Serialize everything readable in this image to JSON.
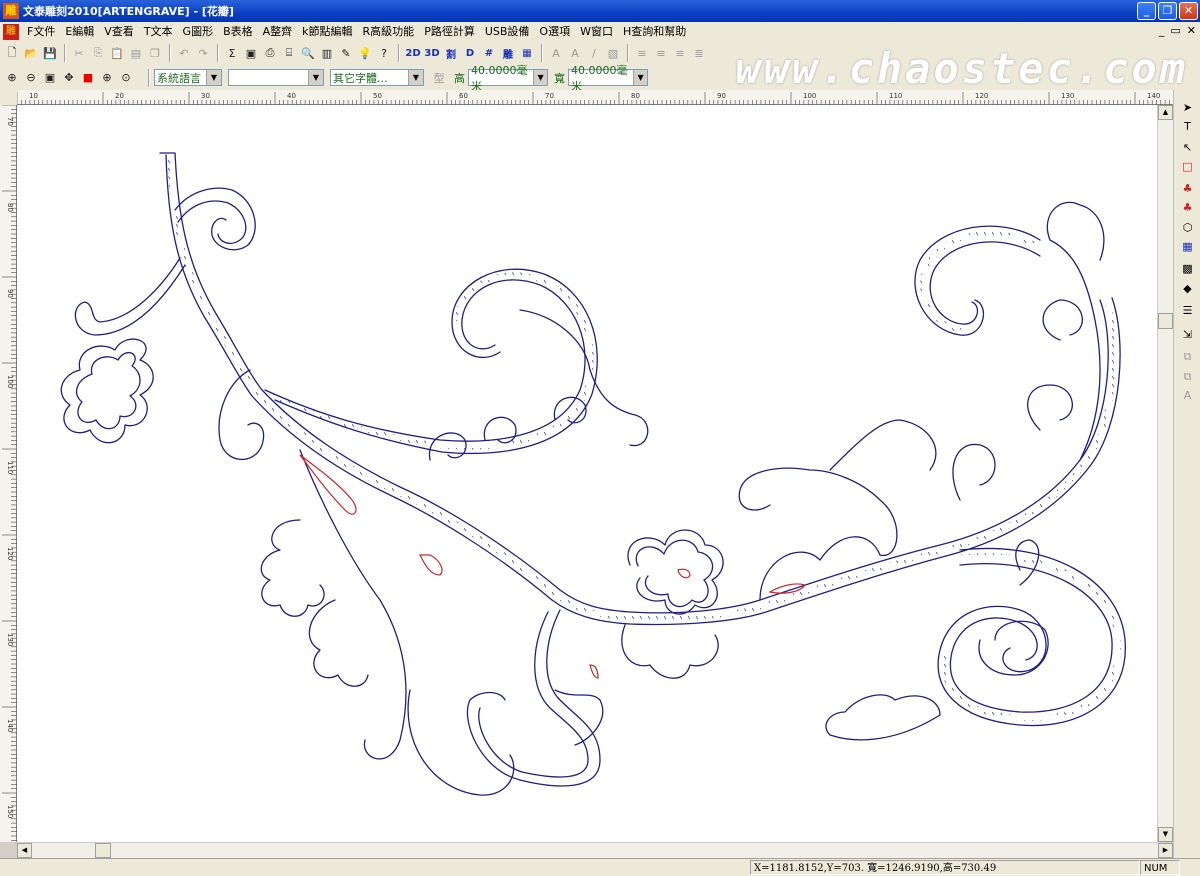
{
  "window": {
    "title": "文泰雕刻2010[ARTENGRAVE] - [花瓣]",
    "app_icon": "雕",
    "controls": [
      "minimize-icon",
      "restore-icon",
      "close-icon"
    ]
  },
  "menu": {
    "logo": "雕",
    "items": [
      "F文件",
      "E編輯",
      "V查看",
      "T文本",
      "G圖形",
      "B表格",
      "A整齊",
      "k節點編輯",
      "R高級功能",
      "P路徑計算",
      "USB設備",
      "O選項",
      "W窗口",
      "H查詢和幫助"
    ],
    "mdi_controls": [
      "_",
      "▭",
      "✕"
    ]
  },
  "toolbar1": {
    "buttons": [
      {
        "name": "new-icon",
        "glyph": "🗋"
      },
      {
        "name": "open-icon",
        "glyph": "📂"
      },
      {
        "name": "save-icon",
        "glyph": "💾"
      },
      {
        "name": "cut-icon",
        "glyph": "✂"
      },
      {
        "name": "copy-icon",
        "glyph": "⎘"
      },
      {
        "name": "paste-icon",
        "glyph": "📋"
      },
      {
        "name": "paste-special-icon",
        "glyph": "▤"
      },
      {
        "name": "clone-icon",
        "glyph": "❐"
      },
      {
        "name": "undo-icon",
        "glyph": "↶"
      },
      {
        "name": "redo-icon",
        "glyph": "↷"
      },
      {
        "name": "path-icon",
        "glyph": "Σ"
      },
      {
        "name": "frame-icon",
        "glyph": "▣"
      },
      {
        "name": "print-icon",
        "glyph": "⎙"
      },
      {
        "name": "print-setup-icon",
        "glyph": "⌸"
      },
      {
        "name": "preview-icon",
        "glyph": "🔍"
      },
      {
        "name": "page-icon",
        "glyph": "▥"
      },
      {
        "name": "eyedropper-icon",
        "glyph": "✎"
      },
      {
        "name": "bulb-icon",
        "glyph": "💡"
      },
      {
        "name": "help-icon",
        "glyph": "?"
      },
      {
        "name": "mode-2d-button",
        "glyph": "2D"
      },
      {
        "name": "mode-3d-button",
        "glyph": "3D"
      },
      {
        "name": "cut-mode-button",
        "glyph": "割"
      },
      {
        "name": "tool-d-icon",
        "glyph": "D"
      },
      {
        "name": "tool-grid-icon",
        "glyph": "#"
      },
      {
        "name": "engrave-button",
        "glyph": "雕"
      },
      {
        "name": "tool-palette-icon",
        "glyph": "▦"
      },
      {
        "name": "text-tool-1-icon",
        "glyph": "A"
      },
      {
        "name": "text-tool-2-icon",
        "glyph": "A"
      },
      {
        "name": "italic-icon",
        "glyph": "/"
      },
      {
        "name": "text-frame-icon",
        "glyph": "▧"
      },
      {
        "name": "align-left-icon",
        "glyph": "≡"
      },
      {
        "name": "align-center-icon",
        "glyph": "≡"
      },
      {
        "name": "align-right-icon",
        "glyph": "≡"
      },
      {
        "name": "align-justify-icon",
        "glyph": "≣"
      }
    ]
  },
  "toolbar2": {
    "zoom_buttons": [
      {
        "name": "zoom-in-icon",
        "glyph": "⊕"
      },
      {
        "name": "zoom-out-icon",
        "glyph": "⊖"
      },
      {
        "name": "zoom-fit-icon",
        "glyph": "▣"
      },
      {
        "name": "pan-icon",
        "glyph": "✥"
      },
      {
        "name": "color-fill-icon",
        "glyph": "■"
      },
      {
        "name": "zoom-selection-icon",
        "glyph": "⊕"
      },
      {
        "name": "zoom-page-icon",
        "glyph": "⊙"
      }
    ],
    "language_select": "系統語言",
    "font_select": "",
    "font_style_select": "其它字體...",
    "type_label": "型",
    "height_label": "高",
    "height_value": "40.0000毫米",
    "width_label": "寬",
    "width_value": "40.0000毫米"
  },
  "watermark": "www.chaostec.com",
  "rulers": {
    "top_labels": [
      "10",
      "20",
      "30",
      "40",
      "50",
      "60",
      "70",
      "80",
      "90",
      "100",
      "110",
      "120",
      "130",
      "140"
    ],
    "left_labels": [
      "70",
      "80",
      "90",
      "100",
      "110",
      "120",
      "130",
      "140",
      "150"
    ]
  },
  "right_toolbar": {
    "buttons": [
      {
        "name": "select-arrow-icon",
        "glyph": "➤"
      },
      {
        "name": "text-tool-icon",
        "glyph": "T"
      },
      {
        "name": "node-edit-icon",
        "glyph": "↖"
      },
      {
        "name": "rectangle-icon",
        "glyph": "□"
      },
      {
        "name": "cherry-icon",
        "glyph": "♣"
      },
      {
        "name": "fruit-icon",
        "glyph": "♣"
      },
      {
        "name": "shapes-icon",
        "glyph": "⬡"
      },
      {
        "name": "table-icon",
        "glyph": "▦"
      },
      {
        "name": "color-grid-icon",
        "glyph": "▩"
      },
      {
        "name": "fill-icon",
        "glyph": "◆"
      },
      {
        "name": "list-icon",
        "glyph": "☰"
      },
      {
        "name": "export-icon",
        "glyph": "⇲"
      },
      {
        "name": "layers-icon",
        "glyph": "⧉"
      },
      {
        "name": "layers-dim-icon",
        "glyph": "⧉"
      },
      {
        "name": "text-ab-icon",
        "glyph": "A"
      }
    ]
  },
  "status": {
    "coords": "X=1181.8152,Y=703. 寬=1246.9190,高=730.49",
    "num": "NUM"
  },
  "colors": {
    "outline": "#1e1e8c",
    "ticks": "#2b33d6",
    "highlight": "#d42424"
  }
}
